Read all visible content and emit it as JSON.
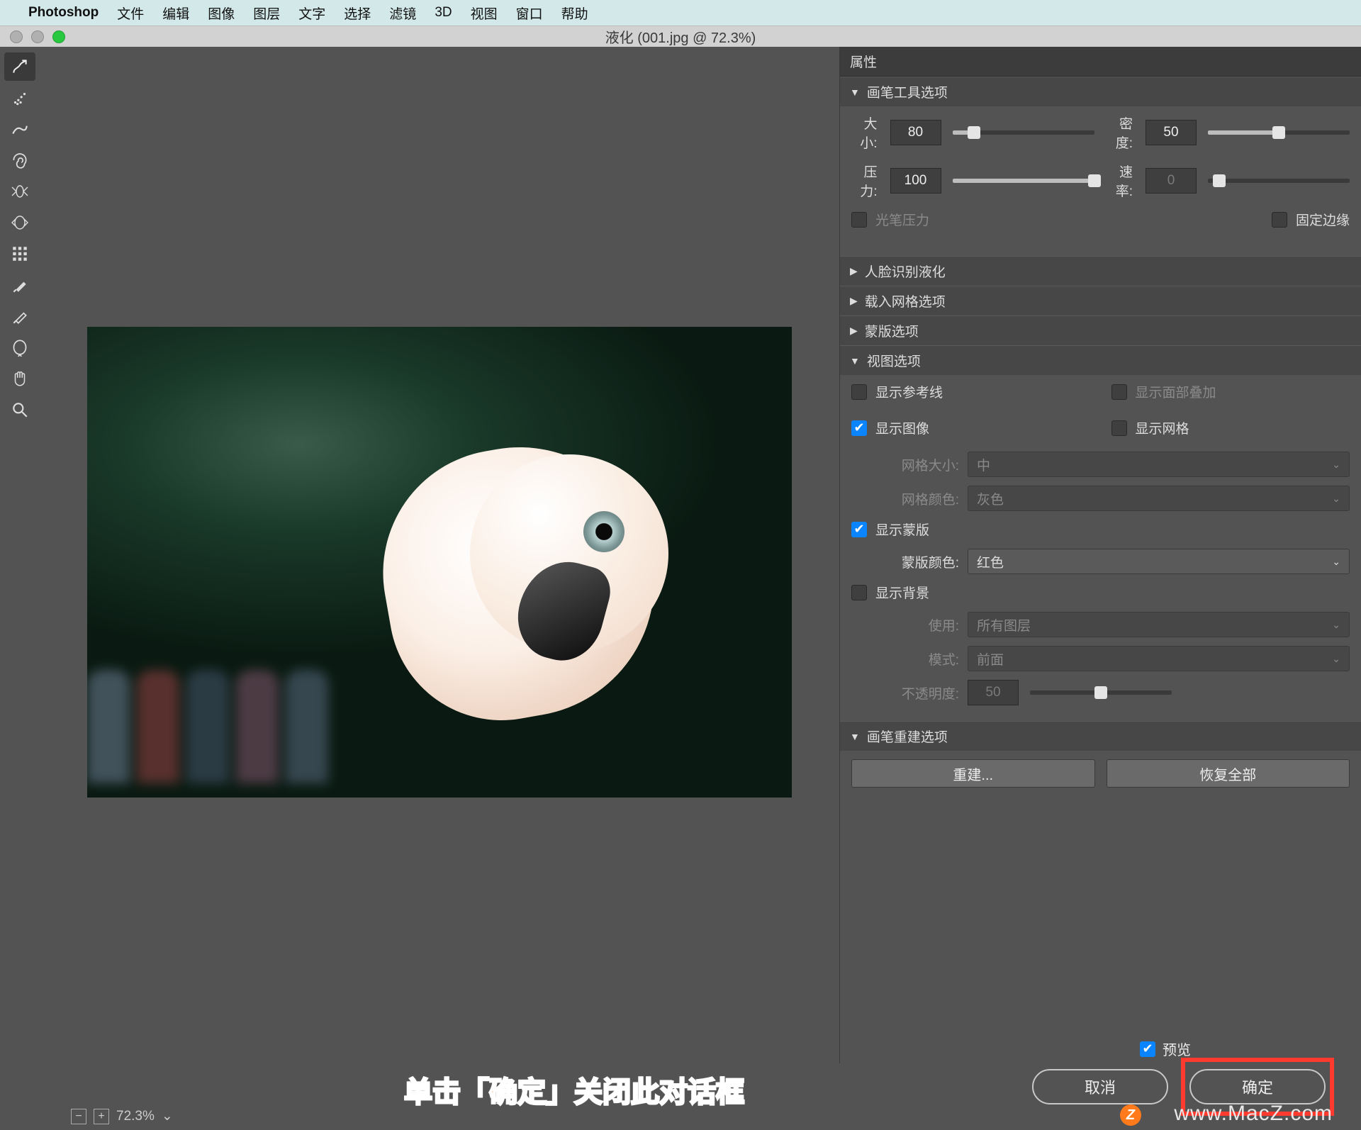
{
  "menubar": {
    "brand": "Photoshop",
    "items": [
      "文件",
      "编辑",
      "图像",
      "图层",
      "文字",
      "选择",
      "滤镜",
      "3D",
      "视图",
      "窗口",
      "帮助"
    ]
  },
  "titlebar": {
    "title": "液化 (001.jpg @ 72.3%)"
  },
  "tools": {
    "icons": [
      "swirl",
      "spray",
      "smooth",
      "twirl",
      "pucker",
      "bloat",
      "noise",
      "push",
      "restore",
      "face",
      "hand",
      "zoom"
    ]
  },
  "panel": {
    "header": "属性",
    "brush_section": {
      "title": "画笔工具选项",
      "size_label": "大小:",
      "size_value": "80",
      "density_label": "密度:",
      "density_value": "50",
      "pressure_label": "压力:",
      "pressure_value": "100",
      "rate_label": "速率:",
      "rate_value": "0",
      "pen_pressure": "光笔压力",
      "fixed_edge": "固定边缘"
    },
    "face_section": {
      "title": "人脸识别液化"
    },
    "mesh_load_section": {
      "title": "载入网格选项"
    },
    "mask_options_section": {
      "title": "蒙版选项"
    },
    "view_section": {
      "title": "视图选项",
      "show_guides": "显示参考线",
      "show_face_overlay": "显示面部叠加",
      "show_image": "显示图像",
      "show_mesh": "显示网格",
      "mesh_size_label": "网格大小:",
      "mesh_size_value": "中",
      "mesh_color_label": "网格颜色:",
      "mesh_color_value": "灰色",
      "show_mask": "显示蒙版",
      "mask_color_label": "蒙版颜色:",
      "mask_color_value": "红色",
      "show_bg": "显示背景",
      "use_label": "使用:",
      "use_value": "所有图层",
      "mode_label": "模式:",
      "mode_value": "前面",
      "opacity_label": "不透明度:",
      "opacity_value": "50"
    },
    "reconstruct_section": {
      "title": "画笔重建选项",
      "rebuild": "重建...",
      "restore_all": "恢复全部"
    }
  },
  "footer": {
    "zoom": "72.3%",
    "preview": "预览",
    "cancel": "取消",
    "ok": "确定",
    "callout": "单击「确定」关闭此对话框",
    "watermark_letter": "Z",
    "watermark": "www.MacZ.com"
  }
}
